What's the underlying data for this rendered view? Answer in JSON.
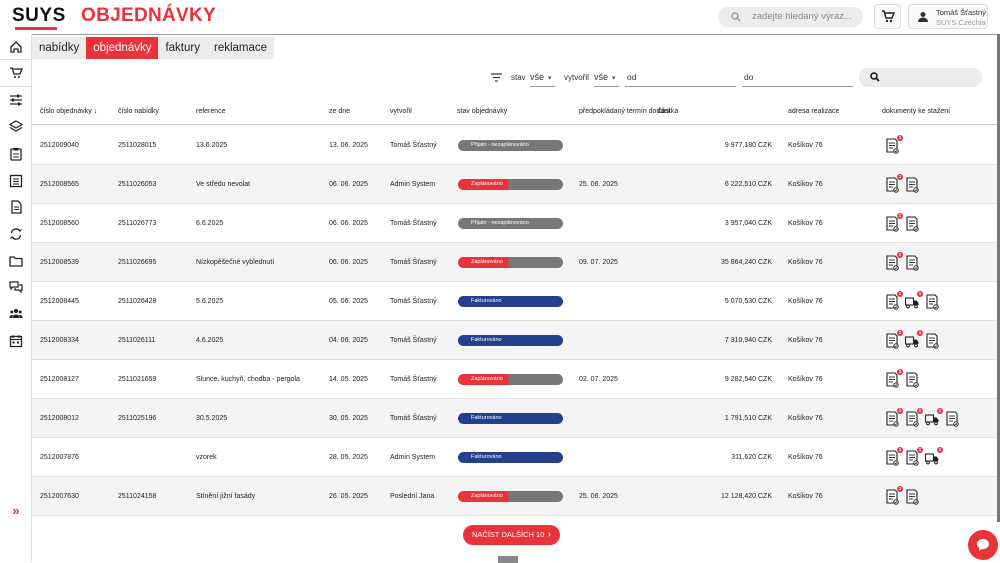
{
  "header": {
    "logo": "SUYS",
    "page_title": "OBJEDNÁVKY",
    "search_placeholder": "zadejte hledaný výraz...",
    "user_name": "Tomáš Šťastný",
    "user_company": "SUYS Czechia",
    "accent_color": "#e8333a"
  },
  "sidebar": {
    "items": [
      "home-icon",
      "cart-icon",
      "sliders-icon",
      "layers-icon",
      "clipboard-icon",
      "list-icon",
      "document-icon",
      "sync-icon",
      "folder-icon",
      "chat-icon",
      "users-icon",
      "calendar-icon"
    ],
    "expand_label": "»"
  },
  "tabs": [
    "nabídky",
    "objednávky",
    "faktury",
    "reklamace"
  ],
  "active_tab": 1,
  "filters": {
    "stav_label": "stav",
    "stav_value": "vše",
    "vytvoril_label": "vytvořil",
    "vytvoril_value": "vše",
    "od_placeholder": "od",
    "do_placeholder": "do"
  },
  "table": {
    "columns": [
      "číslo objednávky",
      "číslo nabídky",
      "reference",
      "ze dne",
      "vytvořil",
      "stav objednávky",
      "předpokládaný termín dodání",
      "částka",
      "adresa realizace",
      "dokumenty ke stažení"
    ],
    "rows": [
      {
        "order": "2512009040",
        "offer": "2511028015",
        "ref": "13.6.2025",
        "date": "13. 06. 2025",
        "by": "Tomáš Šťastný",
        "status": "Přijato - nezaplánováno",
        "status_type": "gray",
        "delivery": "",
        "amount": "9 977,180 CZK",
        "addr": "Košíkov 76",
        "docs": [
          {
            "type": "doc",
            "badge": "1"
          }
        ]
      },
      {
        "order": "2512008565",
        "offer": "2511026053",
        "ref": "Ve středu nevolat",
        "date": "06. 06. 2025",
        "by": "Admin System",
        "status": "Zaplánováno",
        "status_type": "red",
        "delivery": "25. 06. 2025",
        "amount": "6 222,510 CZK",
        "addr": "Košíkov 76",
        "docs": [
          {
            "type": "doc",
            "badge": "1"
          },
          {
            "type": "doc",
            "badge": ""
          }
        ]
      },
      {
        "order": "2512008560",
        "offer": "2511026773",
        "ref": "6.6.2025",
        "date": "06. 06. 2025",
        "by": "Tomáš Šťastný",
        "status": "Přijato - nezaplánováno",
        "status_type": "gray",
        "delivery": "",
        "amount": "3 957,040 CZK",
        "addr": "Košíkov 76",
        "docs": [
          {
            "type": "doc",
            "badge": "1"
          },
          {
            "type": "doc",
            "badge": ""
          }
        ]
      },
      {
        "order": "2512008539",
        "offer": "2511026695",
        "ref": "Nízkopěšečné vyblednutí",
        "date": "06. 06. 2025",
        "by": "Tomáš Šťastný",
        "status": "Zaplánováno",
        "status_type": "red",
        "delivery": "09. 07. 2025",
        "amount": "35 864,240 CZK",
        "addr": "Košíkov 76",
        "docs": [
          {
            "type": "doc",
            "badge": "1"
          },
          {
            "type": "doc",
            "badge": ""
          }
        ]
      },
      {
        "order": "2512008445",
        "offer": "2511026428",
        "ref": "5.6.2025",
        "date": "05. 06. 2025",
        "by": "Tomáš Šťastný",
        "status": "Fakturováno",
        "status_type": "blue",
        "delivery": "",
        "amount": "5 070,530 CZK",
        "addr": "Košíkov 76",
        "docs": [
          {
            "type": "doc",
            "badge": "1"
          },
          {
            "type": "truck",
            "badge": "1"
          },
          {
            "type": "doc",
            "badge": ""
          }
        ]
      },
      {
        "order": "2512008334",
        "offer": "2511026111",
        "ref": "4.6.2025",
        "date": "04. 06. 2025",
        "by": "Tomáš Šťastný",
        "status": "Fakturováno",
        "status_type": "blue",
        "delivery": "",
        "amount": "7 310,940 CZK",
        "addr": "Košíkov 76",
        "docs": [
          {
            "type": "doc",
            "badge": "1"
          },
          {
            "type": "truck",
            "badge": "1"
          },
          {
            "type": "doc",
            "badge": ""
          }
        ]
      },
      {
        "order": "2512008127",
        "offer": "2511021659",
        "ref": "Slunce, kuchyň, chodba - pergola",
        "date": "14. 05. 2025",
        "by": "Tomáš Šťastný",
        "status": "Zaplánováno",
        "status_type": "red",
        "delivery": "02. 07. 2025",
        "amount": "9 282,540 CZK",
        "addr": "Košíkov 76",
        "docs": [
          {
            "type": "doc",
            "badge": "1"
          },
          {
            "type": "doc",
            "badge": ""
          }
        ]
      },
      {
        "order": "2512008012",
        "offer": "2511025196",
        "ref": "30.5.2025",
        "date": "30. 05. 2025",
        "by": "Tomáš Šťastný",
        "status": "Fakturováno",
        "status_type": "blue",
        "delivery": "",
        "amount": "1 791,510 CZK",
        "addr": "Košíkov 76",
        "docs": [
          {
            "type": "doc",
            "badge": "1"
          },
          {
            "type": "doc",
            "badge": "1"
          },
          {
            "type": "truck",
            "badge": "1"
          },
          {
            "type": "doc",
            "badge": ""
          }
        ]
      },
      {
        "order": "2512007876",
        "offer": "",
        "ref": "vzorek",
        "date": "28. 05. 2025",
        "by": "Admin System",
        "status": "Fakturováno",
        "status_type": "blue",
        "delivery": "",
        "amount": "311,620 CZK",
        "addr": "Košíkov 76",
        "docs": [
          {
            "type": "doc",
            "badge": "1"
          },
          {
            "type": "doc",
            "badge": "1"
          },
          {
            "type": "truck",
            "badge": "1"
          }
        ]
      },
      {
        "order": "2512007630",
        "offer": "2511024158",
        "ref": "Stínění jižní fasády",
        "date": "26. 05. 2025",
        "by": "Poslední Jana",
        "status": "Zaplánováno",
        "status_type": "red",
        "delivery": "25. 06. 2025",
        "amount": "12 128,420 CZK",
        "addr": "Košíkov 76",
        "docs": [
          {
            "type": "doc",
            "badge": "1"
          },
          {
            "type": "doc",
            "badge": ""
          }
        ]
      }
    ]
  },
  "load_more_label": "NAČÍST DALŠÍCH 10"
}
